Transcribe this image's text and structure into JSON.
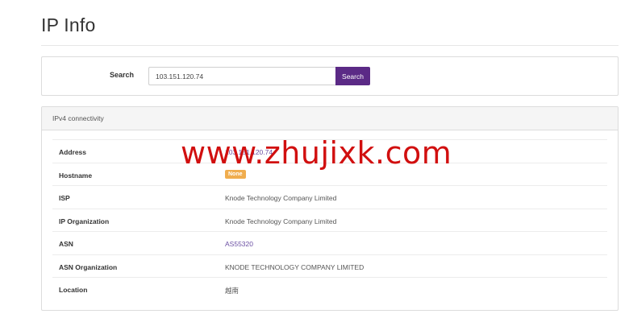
{
  "page": {
    "title": "IP Info"
  },
  "search": {
    "label": "Search",
    "value": "103.151.120.74",
    "button_label": "Search"
  },
  "panel": {
    "title": "IPv4 connectivity",
    "rows": [
      {
        "key": "Address",
        "value": "103.151.120.74",
        "type": "link"
      },
      {
        "key": "Hostname",
        "value": "None",
        "type": "badge"
      },
      {
        "key": "ISP",
        "value": "Knode Technology Company Limited",
        "type": "text"
      },
      {
        "key": "IP Organization",
        "value": "Knode Technology Company Limited",
        "type": "text"
      },
      {
        "key": "ASN",
        "value": "AS55320",
        "type": "link"
      },
      {
        "key": "ASN Organization",
        "value": "KNODE TECHNOLOGY COMPANY LIMITED",
        "type": "text"
      },
      {
        "key": "Location",
        "value": "越南",
        "type": "text"
      }
    ]
  },
  "watermark": {
    "text": "www.zhujixk.com"
  },
  "colors": {
    "accent": "#5b2a86",
    "badge": "#f0ad4e",
    "link": "#6b4fa3",
    "watermark": "#d10f0f"
  }
}
